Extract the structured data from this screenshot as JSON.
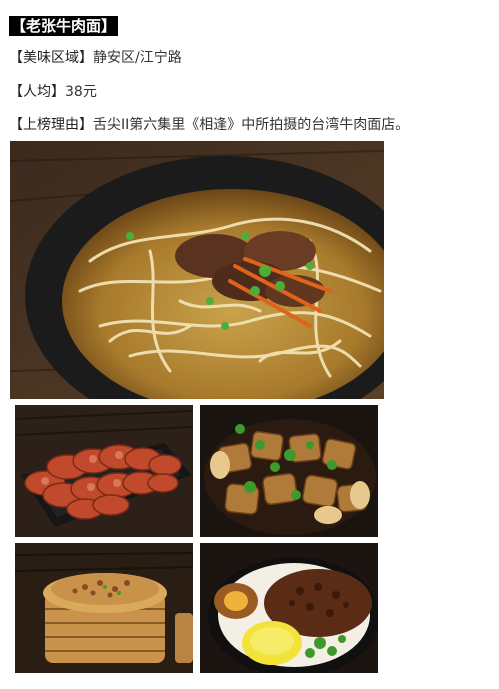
{
  "title": "【老张牛肉面】",
  "area": {
    "label": "【美味区域】",
    "value": "静安区/江宁路"
  },
  "price": {
    "label": "【人均】",
    "value": "38元"
  },
  "reason": {
    "label": "【上榜理由】",
    "value": "舌尖II第六集里《相逢》中所拍摄的台湾牛肉面店。"
  },
  "photos": [
    {
      "subject": "beef-noodle-soup"
    },
    {
      "subject": "sliced-sausage"
    },
    {
      "subject": "braised-tofu"
    },
    {
      "subject": "steamed-rice-basket"
    },
    {
      "subject": "braised-pork-rice"
    }
  ]
}
